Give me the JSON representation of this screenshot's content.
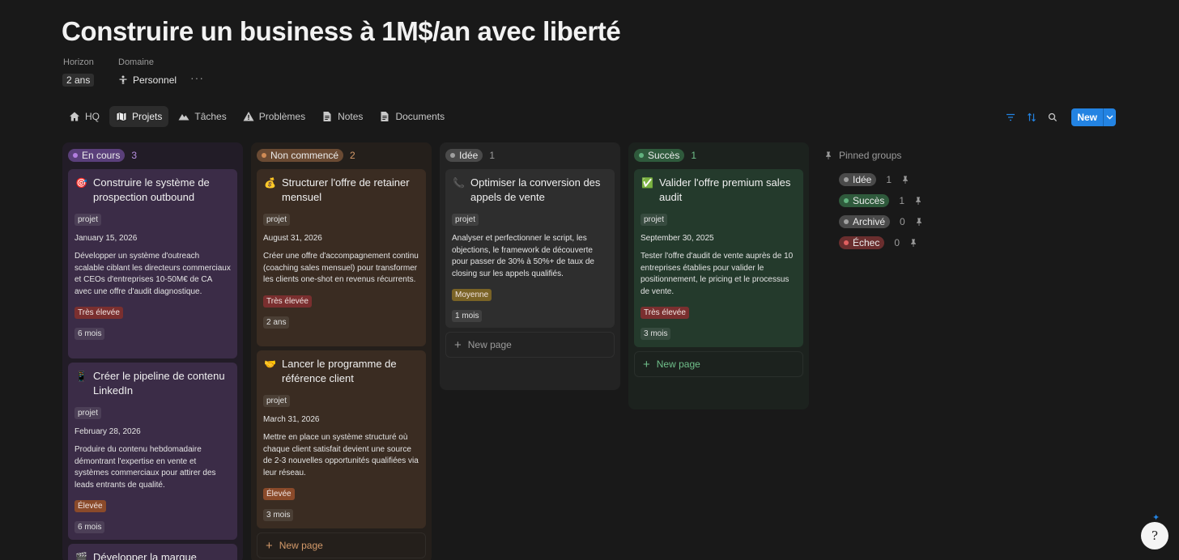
{
  "page": {
    "title": "Construire un business à 1M$/an avec liberté",
    "properties": {
      "horizon": {
        "label": "Horizon",
        "value": "2 ans"
      },
      "domaine": {
        "label": "Domaine",
        "value": "Personnel"
      },
      "more": "···"
    }
  },
  "tabs": [
    {
      "label": "HQ",
      "icon": "house-icon",
      "active": false
    },
    {
      "label": "Projets",
      "icon": "map-icon",
      "active": true
    },
    {
      "label": "Tâches",
      "icon": "mountain-icon",
      "active": false
    },
    {
      "label": "Problèmes",
      "icon": "warning-icon",
      "active": false
    },
    {
      "label": "Notes",
      "icon": "document-icon",
      "active": false
    },
    {
      "label": "Documents",
      "icon": "document-icon",
      "active": false
    }
  ],
  "toolbar": {
    "filter_icon": "filter-icon",
    "sort_icon": "sort-icon",
    "search_icon": "search-icon",
    "new_label": "New"
  },
  "colors": {
    "accent": "#2383e2"
  },
  "columns": [
    {
      "name": "En cours",
      "count": "3",
      "pill_bg": "#5a3f7a",
      "dot": "#b37ee0",
      "bg": "#221c27",
      "card_bg": "#3b2c47",
      "count_color": "#b78fe0",
      "cards": [
        {
          "emoji": "🎯",
          "title": "Construire le système de prospection outbound",
          "tag": "projet",
          "date": "January 15, 2026",
          "desc": "Développer un système d'outreach scalable ciblant les directeurs commerciaux et CEOs d'entreprises 10-50M€ de CA avec une offre d'audit diagnostique.",
          "priority": "Très élevée",
          "priority_bg": "#7a2f2f",
          "duration": "6 mois"
        },
        {
          "emoji": "📱",
          "title": "Créer le pipeline de contenu LinkedIn",
          "tag": "projet",
          "date": "February 28, 2026",
          "desc": "Produire du contenu hebdomadaire démontrant l'expertise en vente et systèmes commerciaux pour attirer des leads entrants de qualité.",
          "priority": "Élevée",
          "priority_bg": "#8a4a2a",
          "duration": "6 mois"
        },
        {
          "emoji": "🎬",
          "title": "Développer la marque"
        }
      ]
    },
    {
      "name": "Non commencé",
      "count": "2",
      "pill_bg": "#6a4a33",
      "dot": "#d08b55",
      "bg": "#241f1b",
      "card_bg": "#3a2c22",
      "count_color": "#d49a6a",
      "cards": [
        {
          "emoji": "💰",
          "title": "Structurer l'offre de retainer mensuel",
          "tag": "projet",
          "date": "August 31, 2026",
          "desc": "Créer une offre d'accompagnement continu (coaching sales mensuel) pour transformer les clients one-shot en revenus récurrents.",
          "priority": "Très élevée",
          "priority_bg": "#7a2f2f",
          "duration": "2 ans"
        },
        {
          "emoji": "🤝",
          "title": "Lancer le programme de référence client",
          "tag": "projet",
          "date": "March 31, 2026",
          "desc": "Mettre en place un système structuré où chaque client satisfait devient une source de 2-3 nouvelles opportunités qualifiées via leur réseau.",
          "priority": "Élevée",
          "priority_bg": "#8a4a2a",
          "duration": "3 mois"
        }
      ],
      "new_page": "New page",
      "new_page_color": "#d49a6a"
    },
    {
      "name": "Idée",
      "count": "1",
      "pill_bg": "#4a4a4a",
      "dot": "#a0a0a0",
      "bg": "#232323",
      "card_bg": "#2e2e2e",
      "count_color": "#9b9b9b",
      "cards": [
        {
          "emoji": "📞",
          "title": "Optimiser la conversion des appels de vente",
          "tag": "projet",
          "date": "",
          "desc": "Analyser et perfectionner le script, les objections, le framework de découverte pour passer de 30% à 50%+ de taux de closing sur les appels qualifiés.",
          "priority": "Moyenne",
          "priority_bg": "#7a6326",
          "duration": "1 mois"
        }
      ],
      "new_page": "New page",
      "new_page_color": "#9b9b9b"
    },
    {
      "name": "Succès",
      "count": "1",
      "pill_bg": "#2f5a3c",
      "dot": "#62b37f",
      "bg": "#1c221e",
      "card_bg": "#243a2c",
      "count_color": "#6fbf8a",
      "cards": [
        {
          "emoji": "✅",
          "title": "Valider l'offre premium sales audit",
          "tag": "projet",
          "date": "September 30, 2025",
          "desc": "Tester l'offre d'audit de vente auprès de 10 entreprises établies pour valider le positionnement, le pricing et le processus de vente.",
          "priority": "Très élevée",
          "priority_bg": "#7a2f2f",
          "duration": "3 mois"
        }
      ],
      "new_page": "New page",
      "new_page_color": "#6fbf8a"
    }
  ],
  "pinned": {
    "label": "Pinned groups",
    "groups": [
      {
        "name": "Idée",
        "count": "1",
        "pill_bg": "#4a4a4a",
        "dot": "#a0a0a0"
      },
      {
        "name": "Succès",
        "count": "1",
        "pill_bg": "#2f5a3c",
        "dot": "#62b37f"
      },
      {
        "name": "Archivé",
        "count": "0",
        "pill_bg": "#4a4a4a",
        "dot": "#a0a0a0"
      },
      {
        "name": "Échec",
        "count": "0",
        "pill_bg": "#6a2e2e",
        "dot": "#e06060"
      }
    ]
  },
  "helper": {
    "icon": "help-avatar-icon",
    "glyph": "?",
    "spark": "✦"
  }
}
